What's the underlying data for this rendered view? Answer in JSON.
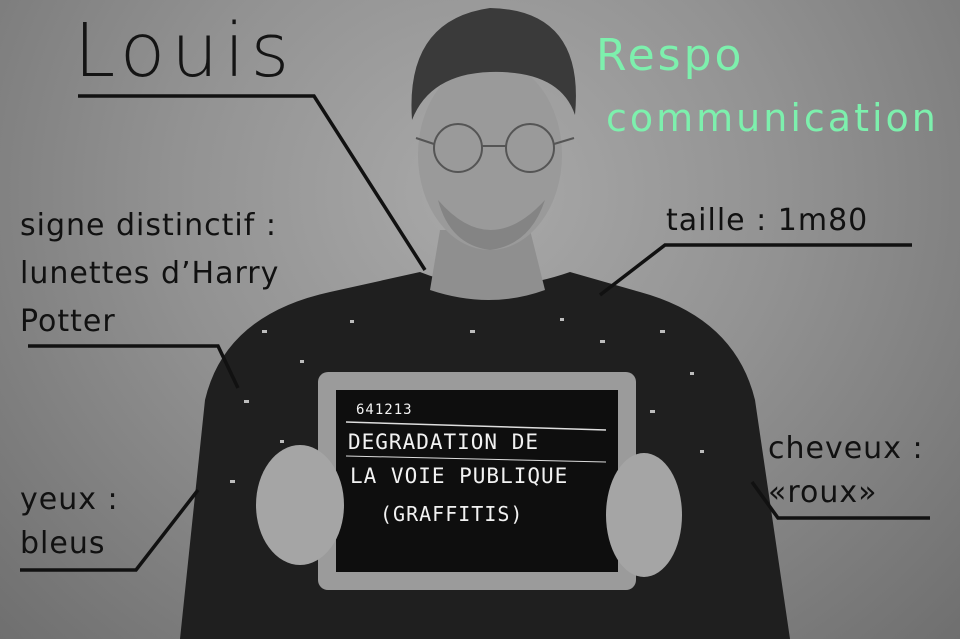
{
  "name": "Louis",
  "role": {
    "line1": "Respo",
    "line2": "communication",
    "color": "#7df0ad"
  },
  "annotations": {
    "signe_distinctif": [
      "signe distinctif :",
      "lunettes d’Harry",
      "Potter"
    ],
    "taille": "taille : 1m80",
    "yeux": [
      "yeux :",
      "bleus"
    ],
    "cheveux": [
      "cheveux :",
      "«roux»"
    ]
  },
  "slate": {
    "number": "641213",
    "line1": "DEGRADATION DE",
    "line2": "LA VOIE PUBLIQUE",
    "line3": "(GRAFFITIS)"
  }
}
